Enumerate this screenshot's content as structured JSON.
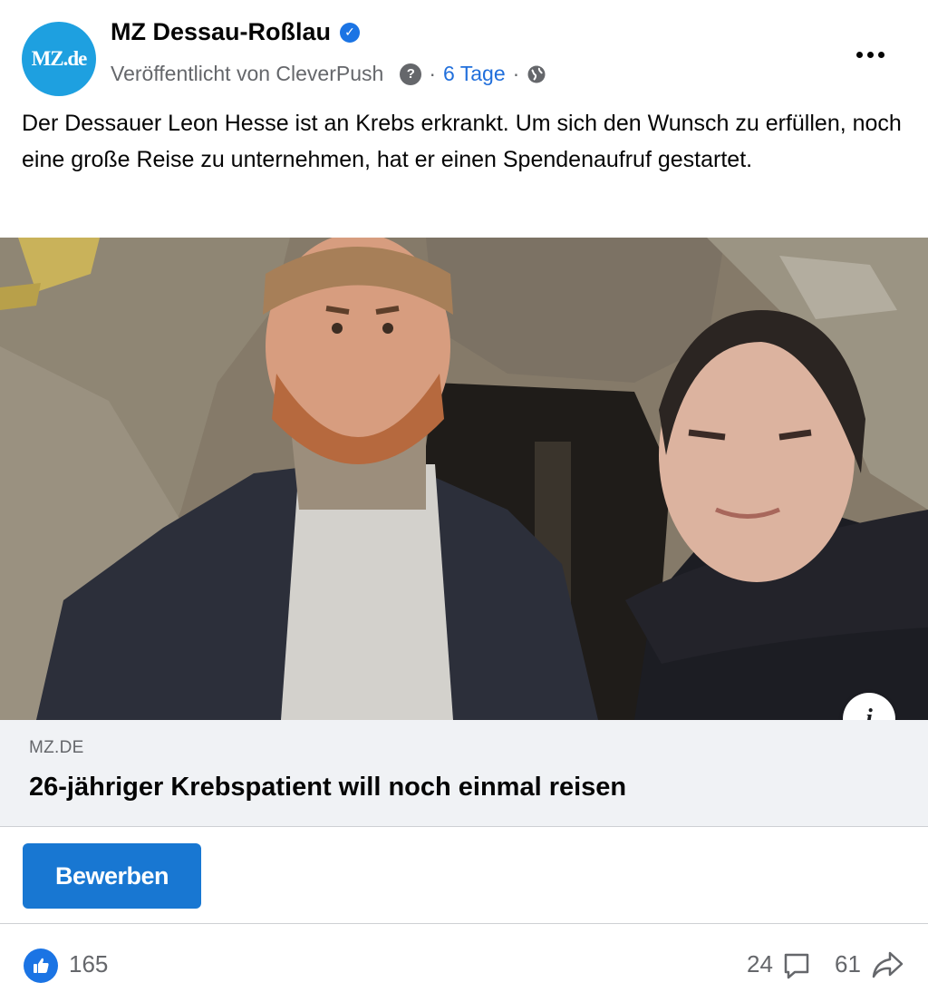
{
  "header": {
    "avatar_text": "MZ.de",
    "page_name": "MZ Dessau-Roßlau",
    "published_by": "Veröffentlicht von CleverPush",
    "separator": "·",
    "time_ago": "6 Tage",
    "icons": [
      "verified-badge-icon",
      "question-icon",
      "globe-icon",
      "more-icon"
    ]
  },
  "post": {
    "text": "Der Dessauer Leon Hesse ist an Krebs erkrankt. Um sich den Wunsch zu erfüllen, noch eine große Reise zu unternehmen, hat er einen Spendenaufruf gestartet."
  },
  "link_preview": {
    "domain": "MZ.DE",
    "title": "26-jähriger Krebspatient will noch einmal reisen",
    "info_icon": "i"
  },
  "cta": {
    "label": "Bewerben"
  },
  "stats": {
    "likes": "165",
    "comments": "24",
    "shares": "61"
  },
  "colors": {
    "accent": "#1b74e4",
    "button": "#1877d2",
    "link_bg": "#f0f2f5",
    "secondary_text": "#65676b",
    "avatar": "#1ea0e0"
  }
}
